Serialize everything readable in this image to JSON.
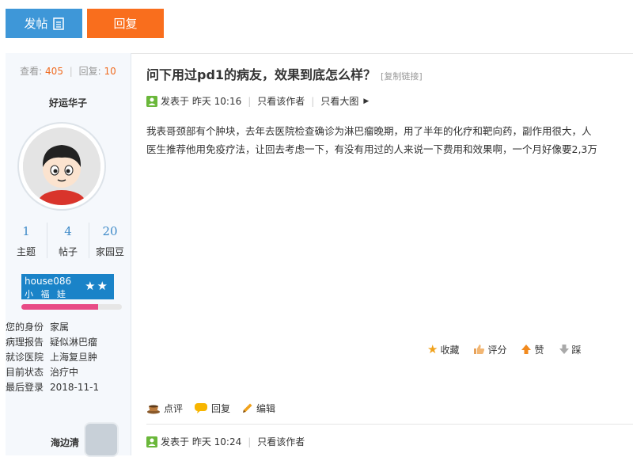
{
  "toolbar": {
    "post_label": "发帖",
    "reply_label": "回复"
  },
  "stats": {
    "views_label": "查看:",
    "views": "405",
    "replies_label": "回复:",
    "replies": "10"
  },
  "author": {
    "name": "好运华子",
    "counts": [
      {
        "value": "1",
        "label": "主题"
      },
      {
        "value": "4",
        "label": "帖子"
      },
      {
        "value": "20",
        "label": "家园豆"
      }
    ],
    "badge": {
      "user": "house086",
      "title": "小 福 娃",
      "stars": "★★"
    },
    "level_fraction": 0.76,
    "info": [
      {
        "key": "您的身份",
        "value": "家属"
      },
      {
        "key": "病理报告",
        "value": "疑似淋巴瘤"
      },
      {
        "key": "就诊医院",
        "value": "上海复旦肿"
      },
      {
        "key": "目前状态",
        "value": "治疗中"
      },
      {
        "key": "最后登录",
        "value": "2018-11-1"
      }
    ]
  },
  "post": {
    "title": "问下用过pd1的病友，效果到底怎么样？",
    "copy_link": "[复制链接]",
    "posted": "发表于 昨天 10:16",
    "author_only": "只看该作者",
    "big_image": "只看大图",
    "lines": [
      "我表哥颈部有个肿块，去年去医院检查确诊为淋巴瘤晚期，用了半年的化疗和靶向药，副作用很大，人",
      "医生推荐他用免疫疗法，让回去考虑一下，有没有用过的人来说一下费用和效果啊，一个月好像要2,3万"
    ],
    "actions_right": {
      "favorite": "收藏",
      "rate": "评分",
      "like": "赞",
      "dislike": "踩"
    },
    "actions_left": {
      "comment": "点评",
      "reply": "回复",
      "edit": "编辑"
    }
  },
  "next_post": {
    "author_name": "海边清",
    "posted": "发表于 昨天 10:24",
    "author_only": "只看该作者"
  },
  "colors": {
    "blue": "#3e97d8",
    "orange": "#f96e1d",
    "accent_num": "#f06c21"
  }
}
